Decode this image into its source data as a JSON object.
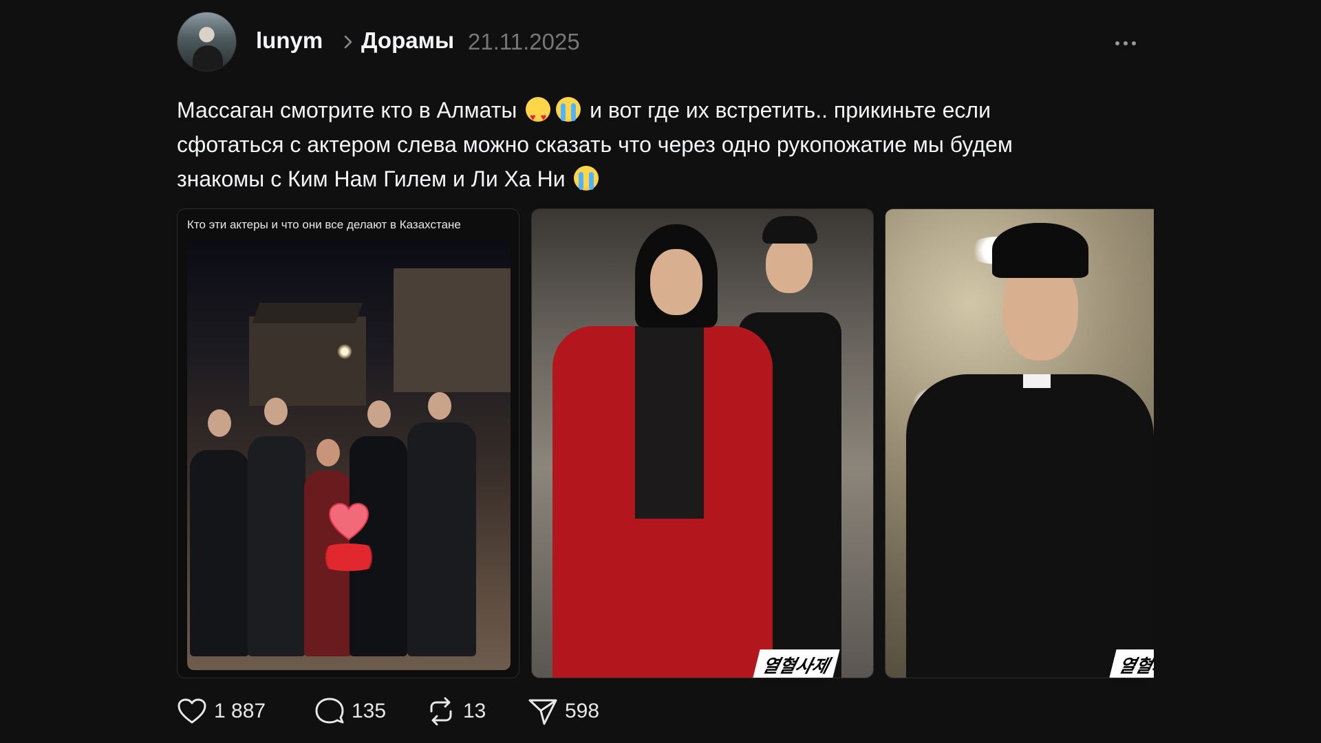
{
  "post": {
    "author": "lunym",
    "community": "Дорамы",
    "date": "21.11.2025",
    "text_lines": [
      "Массаган смотрите кто в Алматы",
      "и вот где их встретить.. прикиньте если",
      "сфотаться с актером слева можно сказать что через одно рукопожатие мы будем",
      "знакомы с Ким Нам Гилем и Ли Ха Ни"
    ],
    "emojis": [
      "heart-eyes-emoji",
      "crying-emoji",
      "crying-emoji"
    ],
    "media": [
      {
        "caption": "Кто эти актеры и что они все делают в Казахстане"
      },
      {
        "watermark": "열혈사제"
      },
      {
        "watermark": "열혈사"
      }
    ],
    "actions": {
      "likes": "1 887",
      "comments": "135",
      "reposts": "13",
      "shares": "598"
    }
  },
  "icons": {
    "more": "more-horizontal-icon",
    "chevron": "chevron-right-icon",
    "like": "heart-icon",
    "comment": "comment-icon",
    "repost": "repost-icon",
    "share": "send-icon"
  },
  "colors": {
    "background": "#101010",
    "primary_text": "#f3f5f7",
    "secondary_text": "#777777",
    "accent_red": "#b3161c"
  }
}
